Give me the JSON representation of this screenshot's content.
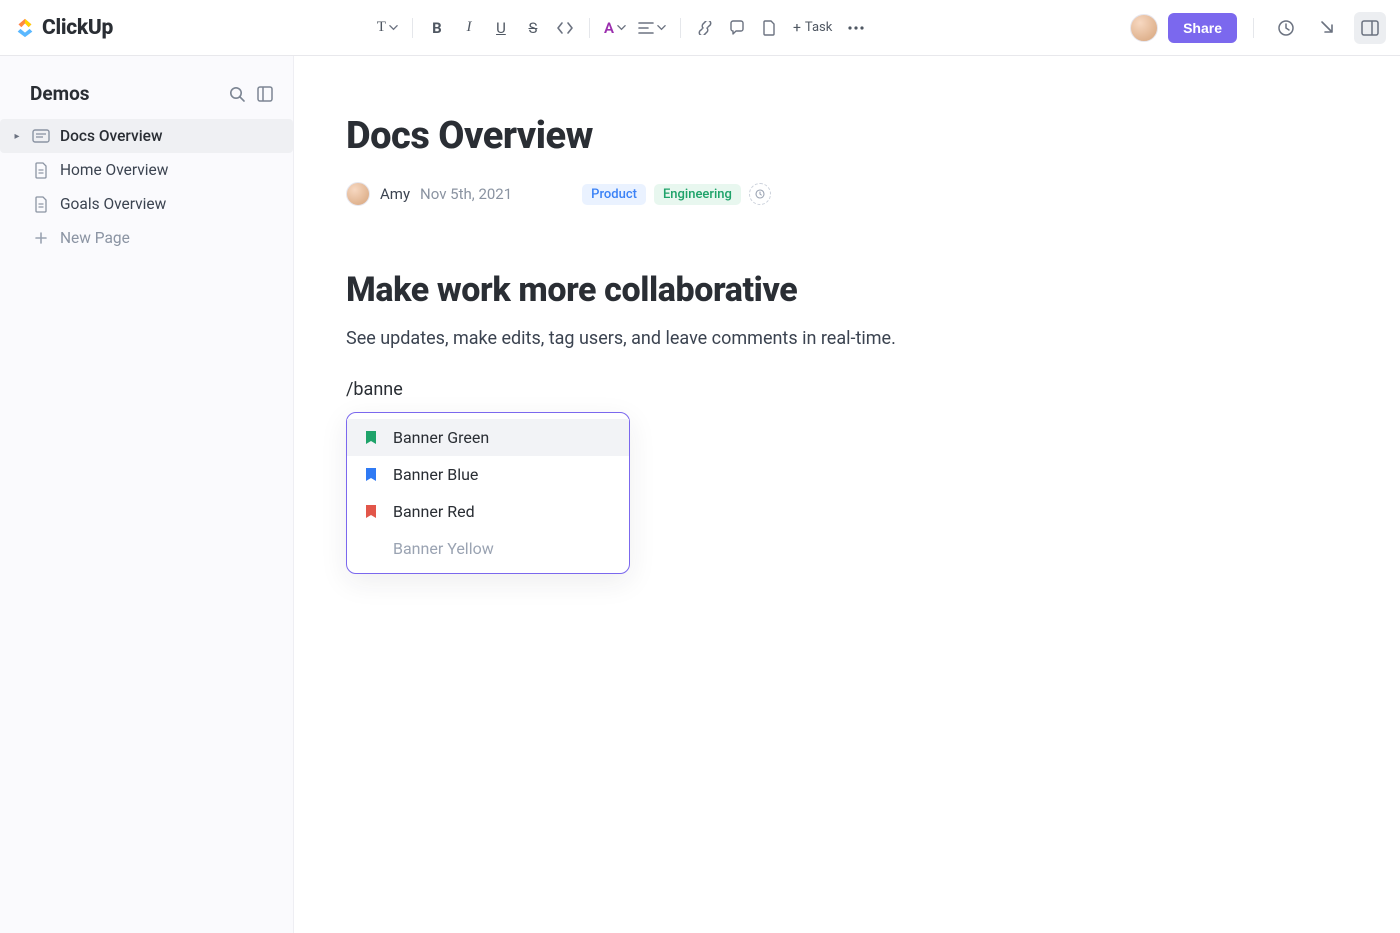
{
  "brand": {
    "name": "ClickUp"
  },
  "toolbar": {
    "text_label": "T",
    "bold_label": "B",
    "italic_label": "I",
    "underline_label": "U",
    "strike_label": "S",
    "color_label": "A",
    "task_label": "Task"
  },
  "share_button": "Share",
  "sidebar": {
    "title": "Demos",
    "items": [
      {
        "label": "Docs Overview",
        "selected": true,
        "icon": "doc-landscape"
      },
      {
        "label": "Home Overview",
        "selected": false,
        "icon": "doc"
      },
      {
        "label": "Goals Overview",
        "selected": false,
        "icon": "doc"
      }
    ],
    "new_page_label": "New Page"
  },
  "doc": {
    "title": "Docs Overview",
    "author": "Amy",
    "date": "Nov 5th, 2021",
    "tags": [
      {
        "label": "Product",
        "class": "product"
      },
      {
        "label": "Engineering",
        "class": "engineering"
      }
    ],
    "heading": "Make work more collaborative",
    "paragraph": "See updates, make edits, tag users, and leave comments in real-time.",
    "slash_text": "/banne",
    "popover": [
      {
        "label": "Banner Green",
        "color": "#1fa36a",
        "highlight": true
      },
      {
        "label": "Banner Blue",
        "color": "#2f7af4",
        "highlight": false
      },
      {
        "label": "Banner Red",
        "color": "#e2564a",
        "highlight": false
      },
      {
        "label": "Banner Yellow",
        "color": "",
        "highlight": false,
        "dim": true
      }
    ]
  }
}
